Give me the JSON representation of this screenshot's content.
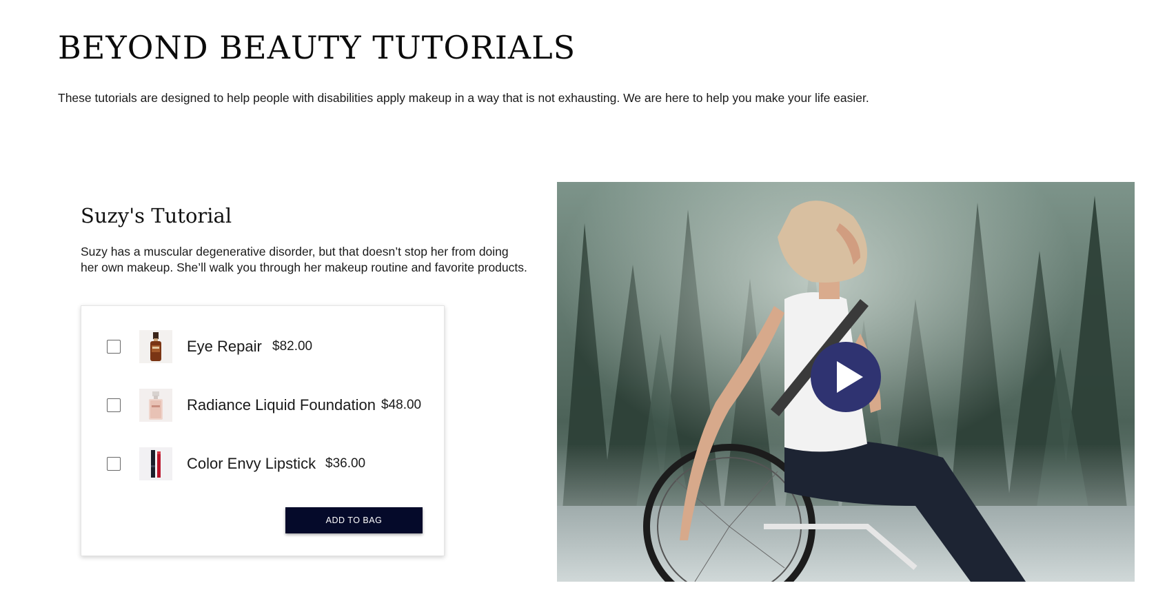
{
  "page": {
    "title": "BEYOND BEAUTY TUTORIALS",
    "intro": "These tutorials are designed to help people with disabilities apply makeup in a way that is not exhausting. We are here to help you make your life easier."
  },
  "tutorial": {
    "heading": "Suzy's Tutorial",
    "description": "Suzy has a muscular degenerative disorder, but that doesn’t stop her from doing her own makeup. She’ll walk you through her makeup routine and favorite products."
  },
  "products": [
    {
      "name": "Eye Repair",
      "price": "$82.00",
      "icon": "serum-bottle-icon"
    },
    {
      "name": "Radiance Liquid Foundation",
      "price": "$48.00",
      "icon": "foundation-bottle-icon"
    },
    {
      "name": "Color Envy Lipstick",
      "price": "$36.00",
      "icon": "lipstick-icon"
    }
  ],
  "cart": {
    "add_label": "ADD TO BAG"
  },
  "video": {
    "icon": "play-icon"
  },
  "colors": {
    "button": "#050a2a",
    "play": "#2f3371"
  }
}
